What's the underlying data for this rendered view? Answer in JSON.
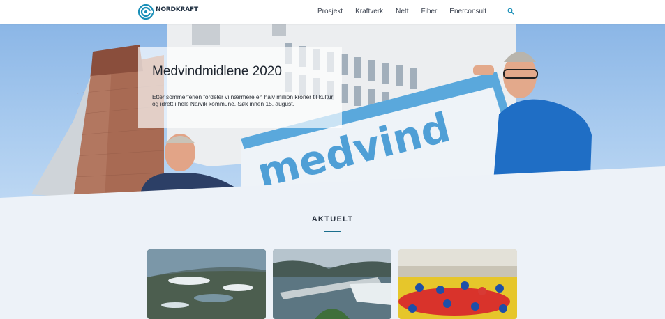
{
  "header": {
    "logo_text": "NORDKRAFT",
    "nav": [
      "Prosjekt",
      "Kraftverk",
      "Nett",
      "Fiber",
      "Enerconsult"
    ],
    "search_icon": "search-icon"
  },
  "hero": {
    "title": "Medvindmidlene 2020",
    "text": "Etter sommerferien fordeler vi nærmere en halv million kroner til kultur og idrett i hele Narvik kommune. Søk innen 15. august.",
    "banner_text": "medvind"
  },
  "aktuelt": {
    "title": "AKTUELT"
  },
  "colors": {
    "brand": "#1a6e8c",
    "background": "#edf2f8",
    "sky": "#9cc2ec"
  }
}
